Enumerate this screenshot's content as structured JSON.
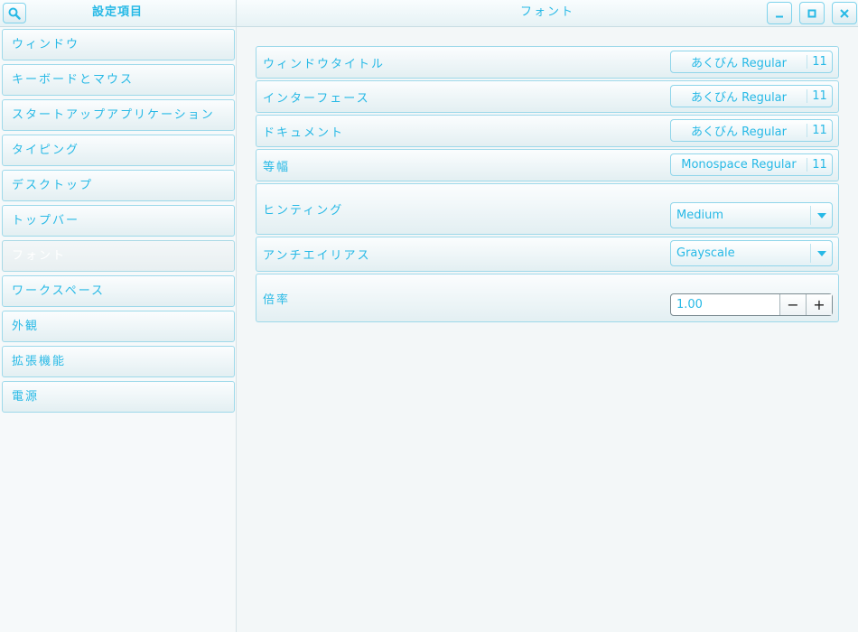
{
  "header": {
    "sidebar_title": "設定項目",
    "window_title": "フォント",
    "search_icon": "search-icon",
    "controls": [
      "minimize-icon",
      "maximize-icon",
      "close-icon"
    ]
  },
  "sidebar": {
    "items": [
      {
        "label": "ウィンドウ",
        "selected": false
      },
      {
        "label": "キーボードとマウス",
        "selected": false
      },
      {
        "label": "スタートアップアプリケーション",
        "selected": false
      },
      {
        "label": "タイピング",
        "selected": false
      },
      {
        "label": "デスクトップ",
        "selected": false
      },
      {
        "label": "トップバー",
        "selected": false
      },
      {
        "label": "フォント",
        "selected": true
      },
      {
        "label": "ワークスペース",
        "selected": false
      },
      {
        "label": "外観",
        "selected": false
      },
      {
        "label": "拡張機能",
        "selected": false
      },
      {
        "label": "電源",
        "selected": false
      }
    ]
  },
  "fonts": [
    {
      "label": "ウィンドウタイトル",
      "font": "あくびん Regular",
      "size": "11"
    },
    {
      "label": "インターフェース",
      "font": "あくびん Regular",
      "size": "11"
    },
    {
      "label": "ドキュメント",
      "font": "あくびん Regular",
      "size": "11"
    },
    {
      "label": "等幅",
      "font": "Monospace Regular",
      "size": "11"
    }
  ],
  "hinting": {
    "label": "ヒンティング",
    "value": "Medium"
  },
  "antialiasing": {
    "label": "アンチエイリアス",
    "value": "Grayscale"
  },
  "scaling": {
    "label": "倍率",
    "value": "1.00",
    "decrement": "−",
    "increment": "+"
  },
  "colors": {
    "accent": "#27b9e6",
    "background": "#f3f7f8",
    "border": "#9ed9ea"
  }
}
